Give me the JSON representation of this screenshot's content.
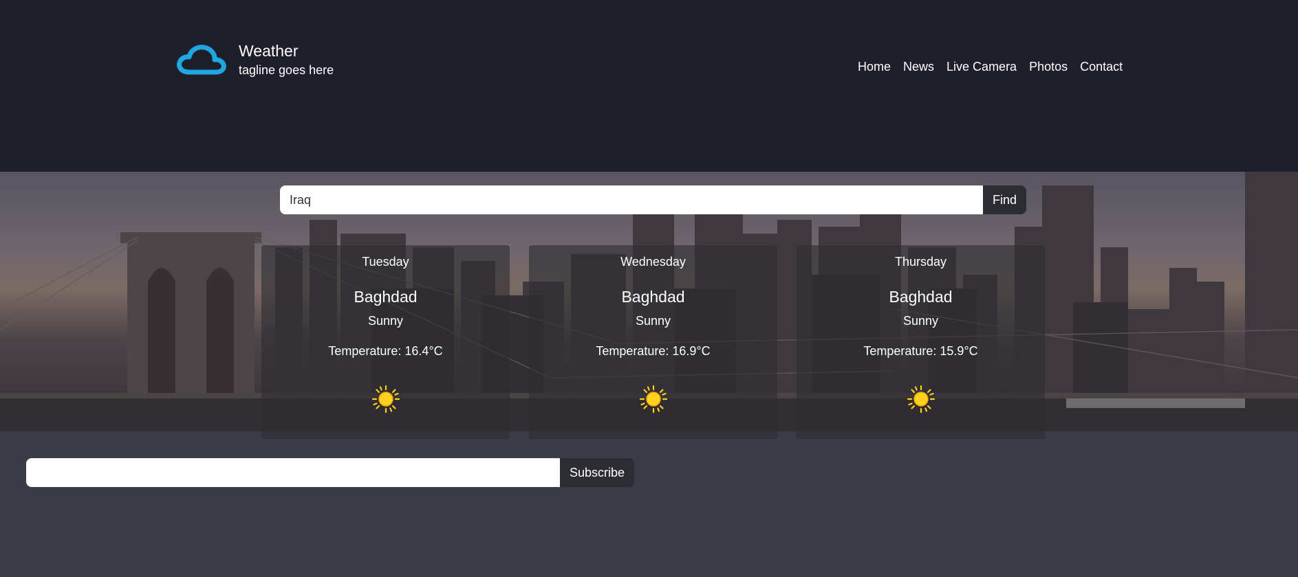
{
  "header": {
    "title": "Weather",
    "tagline": "tagline goes here",
    "logo_icon": "cloud-icon",
    "logo_color": "#1ea7e1",
    "background": "#1e1f2b"
  },
  "nav": {
    "items": [
      "Home",
      "News",
      "Live Camera",
      "Photos",
      "Contact"
    ]
  },
  "search": {
    "value": "Iraq",
    "button_label": "Find"
  },
  "forecast": [
    {
      "day": "Tuesday",
      "city": "Baghdad",
      "condition": "Sunny",
      "temperature": "Temperature: 16.4°C",
      "icon": "sun-icon"
    },
    {
      "day": "Wednesday",
      "city": "Baghdad",
      "condition": "Sunny",
      "temperature": "Temperature: 16.9°C",
      "icon": "sun-icon"
    },
    {
      "day": "Thursday",
      "city": "Baghdad",
      "condition": "Sunny",
      "temperature": "Temperature: 15.9°C",
      "icon": "sun-icon"
    }
  ],
  "subscribe": {
    "value": "",
    "button_label": "Subscribe"
  },
  "colors": {
    "page_background": "#3a3b46",
    "button_background": "#2b2d33",
    "sun": "#ffd21f"
  }
}
